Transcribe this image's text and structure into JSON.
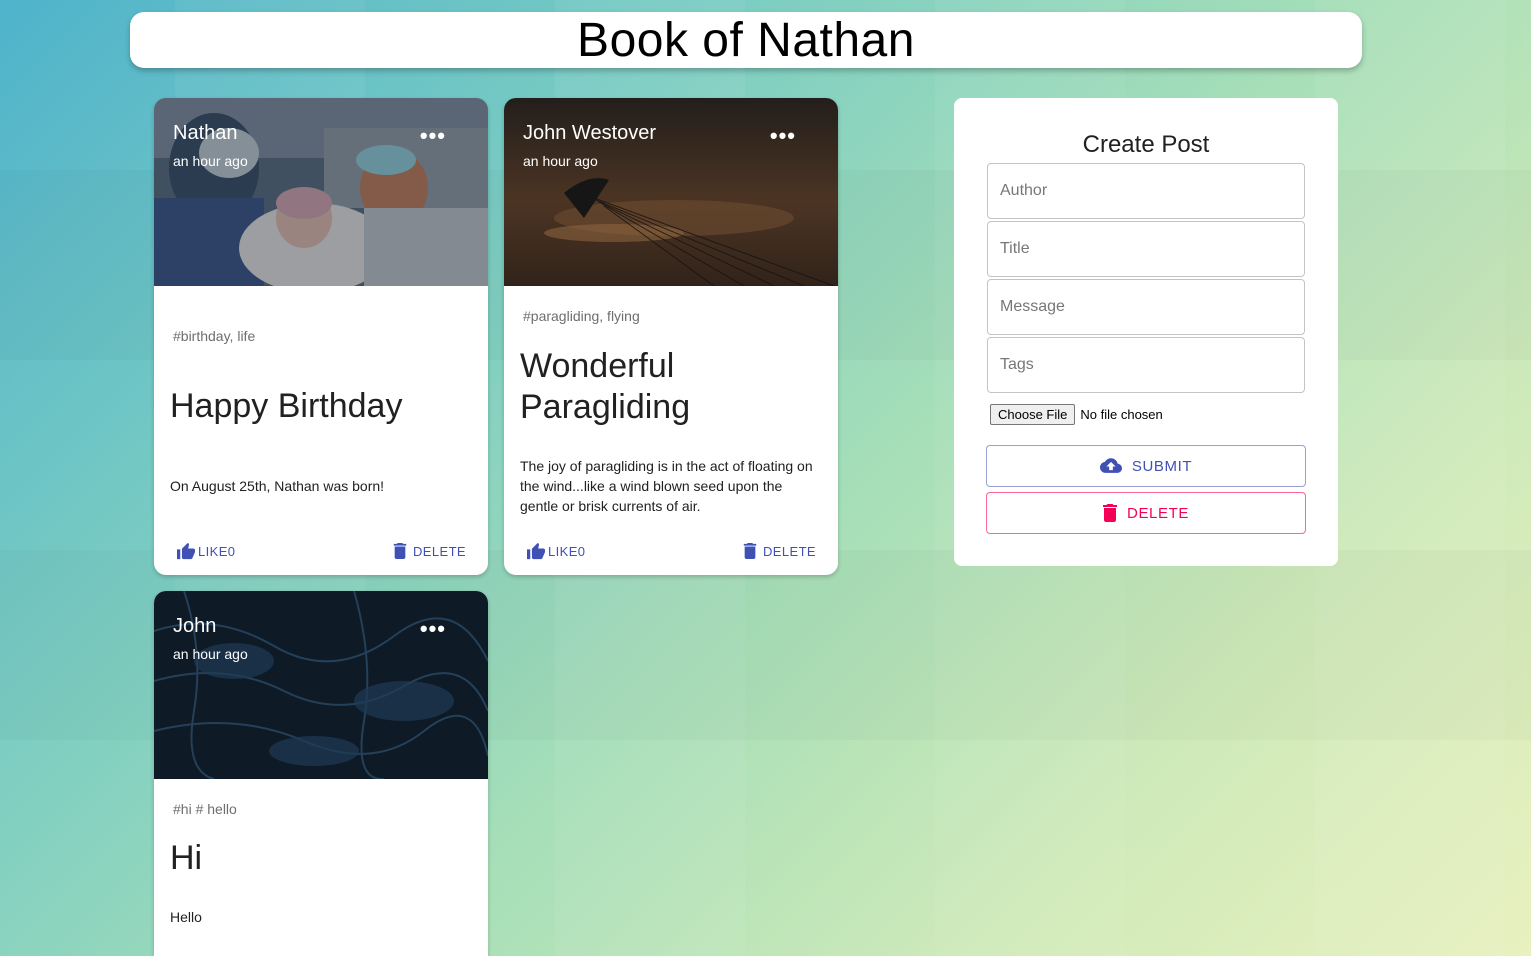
{
  "app": {
    "title": "Book of Nathan"
  },
  "posts": [
    {
      "author": "Nathan",
      "time": "an hour ago",
      "tags": "#birthday, life",
      "title": "Happy Birthday",
      "message": "On August 25th, Nathan was born!",
      "like_label": "LIKE",
      "like_count": "0",
      "delete_label": "DELETE",
      "menu": "•••",
      "image": "hospital-newborn-photo"
    },
    {
      "author": "John Westover",
      "time": "an hour ago",
      "tags": "#paragliding, flying",
      "title": "Wonderful Paragliding",
      "message": "The joy of paragliding is in the act of floating on the wind...like a wind blown seed upon the gentle or brisk currents of air.",
      "like_label": "LIKE",
      "like_count": "0",
      "delete_label": "DELETE",
      "menu": "•••",
      "image": "paraglider-sunset-photo"
    },
    {
      "author": "John",
      "time": "an hour ago",
      "tags": "#hi # hello",
      "title": "Hi",
      "message": "Hello",
      "menu": "•••",
      "image": "dark-blue-texture-photo"
    }
  ],
  "form": {
    "heading": "Create Post",
    "author_placeholder": "Author",
    "title_placeholder": "Title",
    "message_placeholder": "Message",
    "tags_placeholder": "Tags",
    "choose_file_label": "Choose File",
    "no_file_text": "No file chosen",
    "submit_label": "SUBMIT",
    "delete_label": "DELETE"
  },
  "colors": {
    "primary": "#3f51b5",
    "secondary": "#f50057"
  }
}
